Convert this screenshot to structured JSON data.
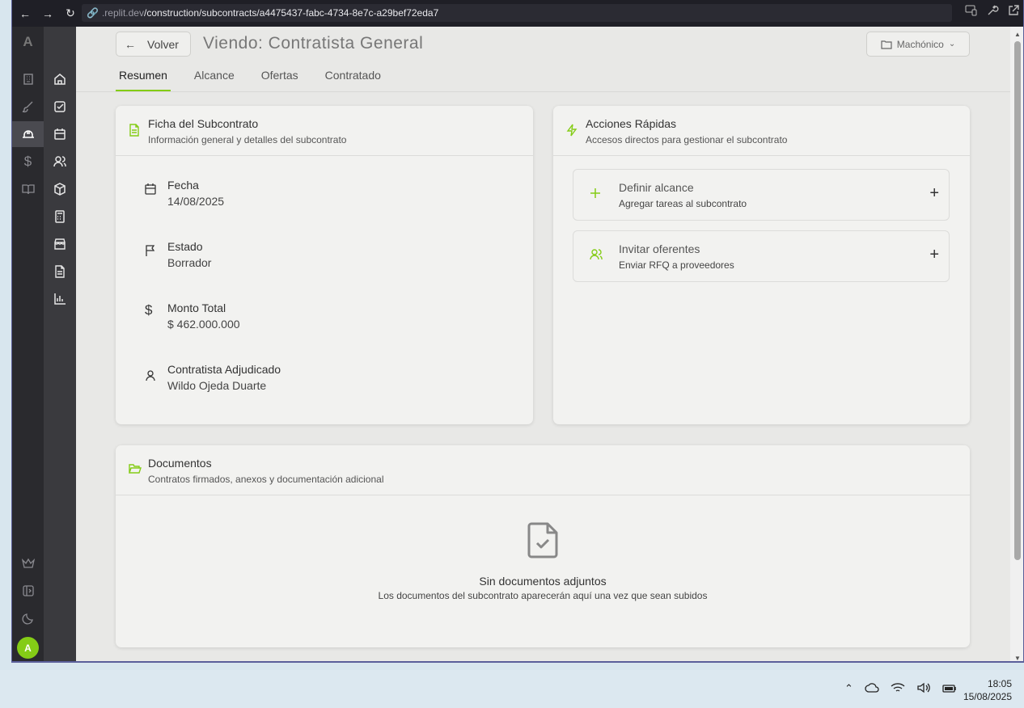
{
  "browser": {
    "url_host": ".replit.dev",
    "url_path": "/construction/subcontracts/a4475437-fabc-4734-8e7c-a29bef72eda7"
  },
  "rail": {
    "logo": "A",
    "avatar": "A"
  },
  "header": {
    "back_label": "Volver",
    "title": "Viendo: Contratista General",
    "project_label": "Machónico"
  },
  "tabs": [
    {
      "label": "Resumen",
      "active": true
    },
    {
      "label": "Alcance"
    },
    {
      "label": "Ofertas"
    },
    {
      "label": "Contratado"
    }
  ],
  "ficha": {
    "title": "Ficha del Subcontrato",
    "subtitle": "Información general y detalles del subcontrato",
    "fields": [
      {
        "label": "Fecha",
        "value": "14/08/2025",
        "icon": "calendar-icon"
      },
      {
        "label": "Estado",
        "value": "Borrador",
        "icon": "flag-icon"
      },
      {
        "label": "Monto Total",
        "value": "$ 462.000.000",
        "icon": "dollar-icon"
      },
      {
        "label": "Contratista Adjudicado",
        "value": "Wildo Ojeda Duarte",
        "icon": "user-icon"
      }
    ]
  },
  "acciones": {
    "title": "Acciones Rápidas",
    "subtitle": "Accesos directos para gestionar el subcontrato",
    "items": [
      {
        "title": "Definir alcance",
        "subtitle": "Agregar tareas al subcontrato",
        "icon": "plus-icon"
      },
      {
        "title": "Invitar oferentes",
        "subtitle": "Enviar RFQ a proveedores",
        "icon": "users-icon"
      }
    ]
  },
  "documentos": {
    "title": "Documentos",
    "subtitle": "Contratos firmados, anexos y documentación adicional",
    "empty_title": "Sin documentos adjuntos",
    "empty_subtitle": "Los documentos del subcontrato aparecerán aquí una vez que sean subidos"
  },
  "taskbar": {
    "time": "18:05",
    "date": "15/08/2025"
  },
  "colors": {
    "accent": "#84cc16",
    "sidebar_dark": "#2a2a2e",
    "sidebar": "#3a3a3e",
    "content_bg": "#e8e8e6"
  }
}
